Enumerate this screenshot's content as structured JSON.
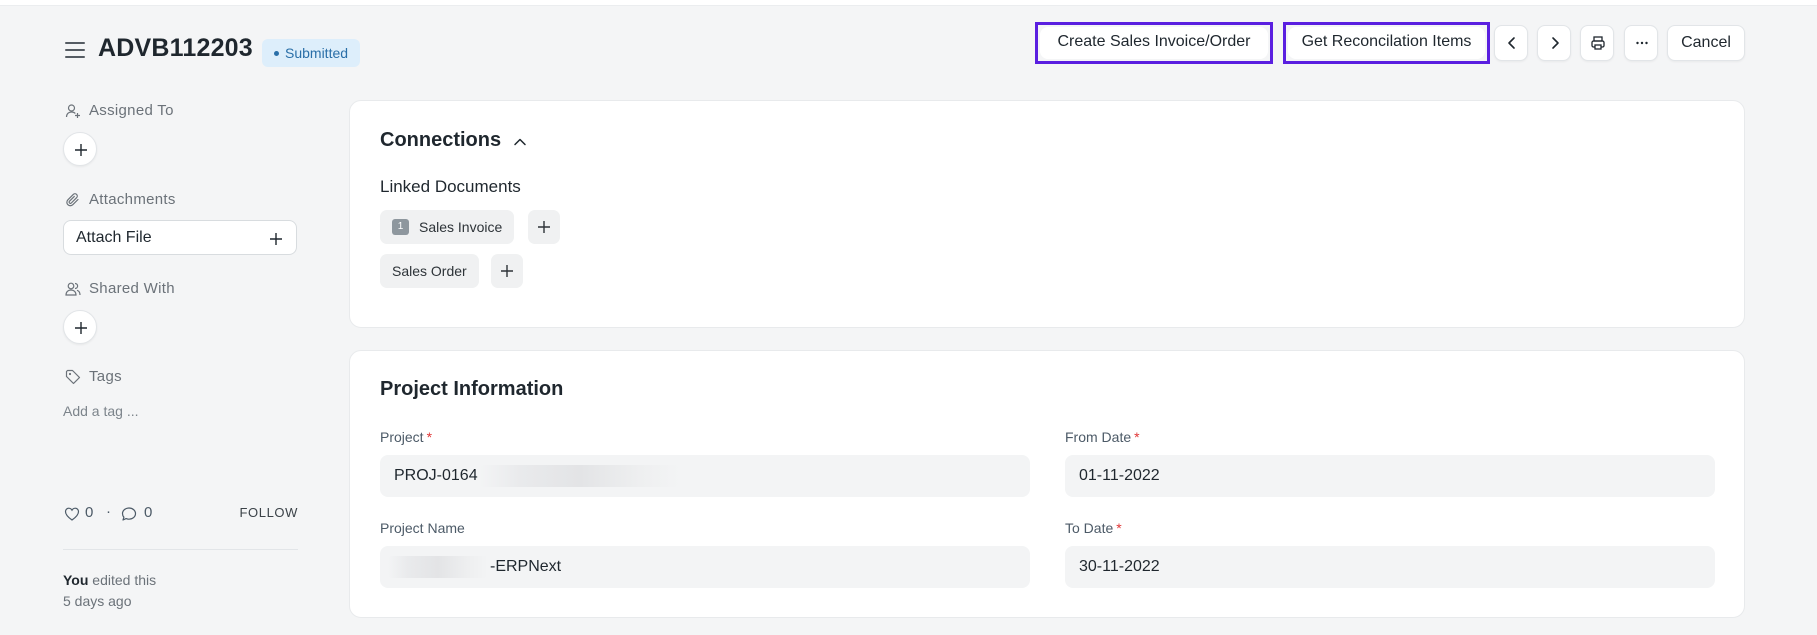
{
  "header": {
    "doc_id": "ADVB112203",
    "status": "Submitted",
    "actions": {
      "create_invoice": "Create Sales Invoice/Order",
      "get_reconciliation": "Get Reconcilation Items",
      "cancel": "Cancel"
    }
  },
  "sidebar": {
    "assigned_to": "Assigned To",
    "attachments": "Attachments",
    "attach_file": "Attach File",
    "shared_with": "Shared With",
    "tags": "Tags",
    "add_tag": "Add a tag ...",
    "likes": "0",
    "comments": "0",
    "follow": "FOLLOW",
    "activity_user": "You",
    "activity_text": " edited this",
    "activity_time": "5 days ago"
  },
  "connections": {
    "title": "Connections",
    "linked_docs_title": "Linked Documents",
    "docs": [
      {
        "label": "Sales Invoice",
        "count": "1"
      },
      {
        "label": "Sales Order",
        "count": ""
      }
    ]
  },
  "project_info": {
    "title": "Project Information",
    "project_label": "Project",
    "project_value": "PROJ-0164",
    "from_date_label": "From Date",
    "from_date_value": "01-11-2022",
    "project_name_label": "Project Name",
    "project_name_value": "-ERPNext",
    "to_date_label": "To Date",
    "to_date_value": "30-11-2022"
  },
  "colors": {
    "highlight": "#5a1fe0",
    "badge_bg": "#ddeefb",
    "badge_text": "#2a6fa8",
    "required": "#e03636"
  },
  "icons": [
    "menu-icon",
    "chevron-left-icon",
    "chevron-right-icon",
    "printer-icon",
    "more-icon",
    "user-plus-icon",
    "paperclip-icon",
    "users-icon",
    "tag-icon",
    "heart-icon",
    "comment-icon",
    "plus-icon",
    "chevron-up-icon"
  ]
}
